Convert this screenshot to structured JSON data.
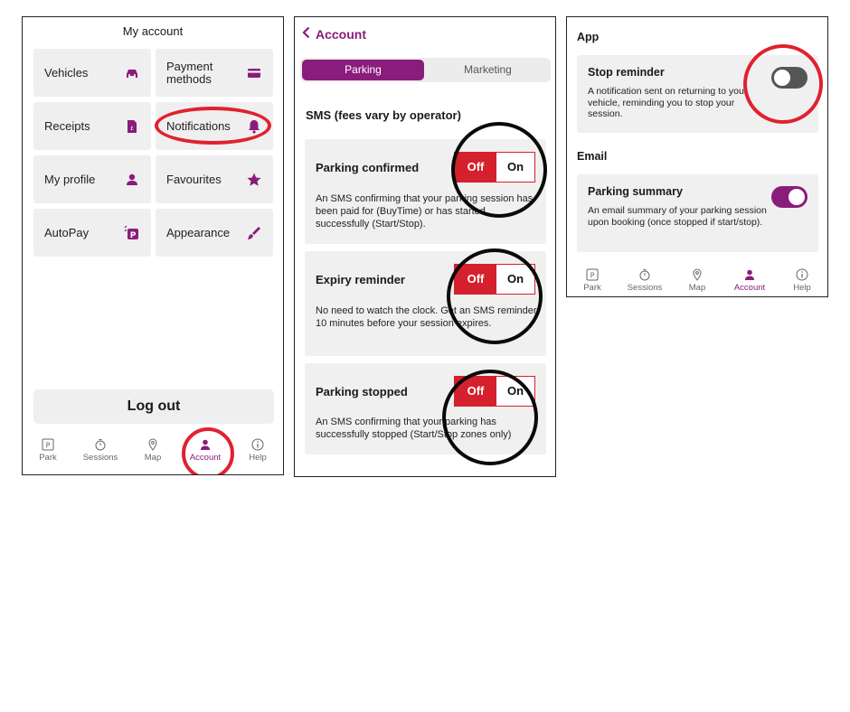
{
  "panel1": {
    "title": "My account",
    "tiles": [
      {
        "label": "Vehicles",
        "icon": "car-icon"
      },
      {
        "label": "Payment\nmethods",
        "icon": "credit-card-icon"
      },
      {
        "label": "Receipts",
        "icon": "receipt-icon"
      },
      {
        "label": "Notifications",
        "icon": "bell-icon"
      },
      {
        "label": "My profile",
        "icon": "person-icon"
      },
      {
        "label": "Favourites",
        "icon": "star-icon"
      },
      {
        "label": "AutoPay",
        "icon": "autopay-icon"
      },
      {
        "label": "Appearance",
        "icon": "paintbrush-icon"
      }
    ],
    "logout_label": "Log out"
  },
  "nav": {
    "items": [
      {
        "label": "Park",
        "icon": "parking-icon"
      },
      {
        "label": "Sessions",
        "icon": "timer-icon"
      },
      {
        "label": "Map",
        "icon": "map-pin-icon"
      },
      {
        "label": "Account",
        "icon": "person-icon",
        "active": true
      },
      {
        "label": "Help",
        "icon": "info-icon"
      }
    ]
  },
  "panel2": {
    "back_label": "Account",
    "tabs": [
      "Parking",
      "Marketing"
    ],
    "section_title": "SMS (fees vary by operator)",
    "cards": [
      {
        "title": "Parking confirmed",
        "desc": "An SMS confirming that your parking session has been paid for (BuyTime) or has started successfully (Start/Stop).",
        "off": "Off",
        "on": "On"
      },
      {
        "title": "Expiry reminder",
        "desc": "No need to watch the clock. Get an SMS reminder 10 minutes before your session expires.",
        "off": "Off",
        "on": "On"
      },
      {
        "title": "Parking stopped",
        "desc": "An SMS confirming that your parking has successfully stopped (Start/Stop zones only)",
        "off": "Off",
        "on": "On"
      }
    ]
  },
  "panel3": {
    "app_heading": "App",
    "stop_reminder": {
      "title": "Stop reminder",
      "desc": "A notification sent on returning to your vehicle, reminding you to stop your session.",
      "enabled": false
    },
    "email_heading": "Email",
    "parking_summary": {
      "title": "Parking summary",
      "desc": "An email summary of your parking session upon booking (once stopped if start/stop).",
      "enabled": true
    }
  },
  "colors": {
    "brand": "#8a1c7c",
    "alert_red": "#d5202e",
    "highlight_ring": "#e0212f"
  }
}
